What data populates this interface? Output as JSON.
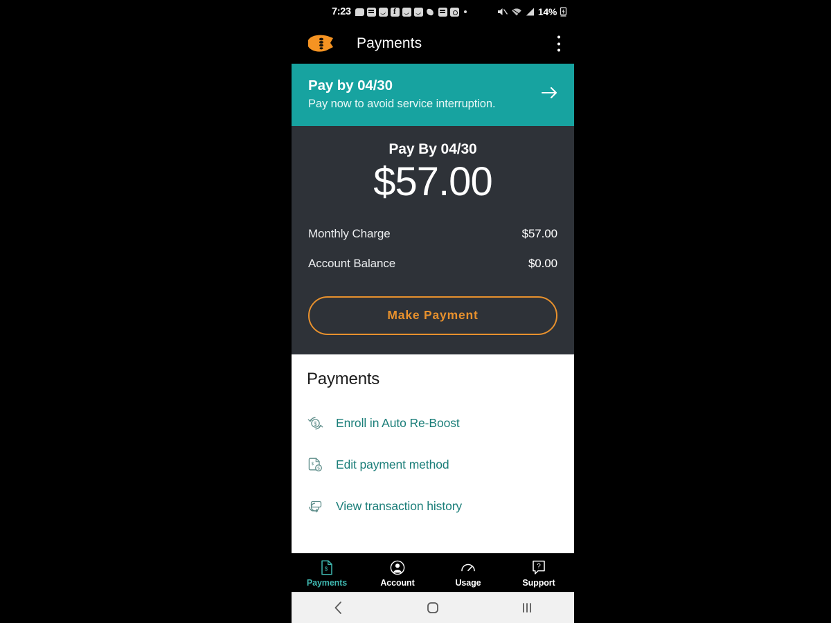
{
  "status_bar": {
    "time": "7:23",
    "battery": "14%",
    "icons": [
      "chat-bubble-icon",
      "message-icon",
      "messenger-icon",
      "facebook-icon",
      "messenger-icon",
      "messenger-icon",
      "phone-icon",
      "calendar-icon",
      "camera-icon"
    ],
    "right_icons": [
      "mute-icon",
      "wifi-icon",
      "cellular-signal-icon",
      "battery-charging-icon"
    ]
  },
  "app_bar": {
    "logo": "boost-logo-icon",
    "title": "Payments",
    "overflow": "overflow-menu-icon"
  },
  "alert_banner": {
    "title": "Pay by 04/30",
    "subtitle": "Pay now to avoid service interruption.",
    "arrow": "arrow-right-icon",
    "background_color": "#17a3a0"
  },
  "summary": {
    "due_label": "Pay By 04/30",
    "amount": "$57.00",
    "rows": [
      {
        "label": "Monthly Charge",
        "value": "$57.00"
      },
      {
        "label": "Account Balance",
        "value": "$0.00"
      }
    ],
    "pay_button": "Make Payment",
    "accent_color": "#e8912d",
    "background_color": "#2e3238"
  },
  "payments_list": {
    "heading": "Payments",
    "links": [
      {
        "label": "Enroll in Auto Re-Boost",
        "icon": "auto-refresh-dollar-icon"
      },
      {
        "label": "Edit payment method",
        "icon": "document-dollar-icon"
      },
      {
        "label": "View transaction history",
        "icon": "transaction-history-icon"
      }
    ],
    "link_color": "#1b7e79"
  },
  "tab_bar": {
    "tabs": [
      {
        "label": "Payments",
        "icon": "payments-document-icon",
        "active": true
      },
      {
        "label": "Account",
        "icon": "account-person-icon",
        "active": false
      },
      {
        "label": "Usage",
        "icon": "usage-gauge-icon",
        "active": false
      },
      {
        "label": "Support",
        "icon": "support-question-icon",
        "active": false
      }
    ],
    "active_color": "#3fb8b0"
  },
  "nav_bar": {
    "buttons": [
      "back-icon",
      "home-icon",
      "recents-icon"
    ]
  }
}
